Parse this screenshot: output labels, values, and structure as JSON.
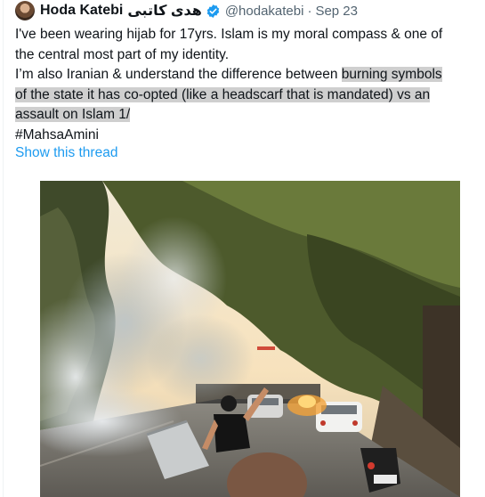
{
  "tweet": {
    "author_name": "Hoda Katebi",
    "author_name_alt": "هدی کاتبی",
    "verified_icon": "verified-badge-icon",
    "handle": "@hodakatebi",
    "separator": "·",
    "date": "Sep 23",
    "lines": {
      "l1": "I've been wearing hijab for 17yrs. Islam is my moral compass & one of",
      "l2": "the central most part of my identity.",
      "l3a": "I’m also Iranian & understand the difference between ",
      "l3b": "burning symbols",
      "l4": "of the state it has co-opted (like a headscarf that is mandated) vs an",
      "l5": "assault on Islam 1/",
      "l6": "#MahsaAmini"
    },
    "show_thread_label": "Show this thread"
  },
  "colors": {
    "text": "#0f1419",
    "secondary": "#536471",
    "link": "#1d9bf0",
    "highlight": "#cfcfcf"
  }
}
